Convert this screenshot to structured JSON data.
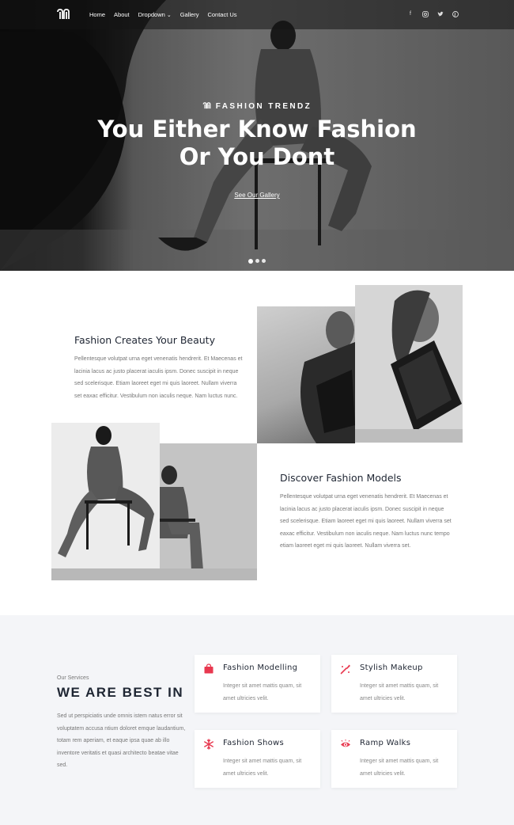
{
  "nav": {
    "items": [
      {
        "label": "Home"
      },
      {
        "label": "About"
      },
      {
        "label": "Dropdown"
      },
      {
        "label": "Gallery"
      },
      {
        "label": "Contact Us"
      }
    ],
    "social_icons": [
      "facebook-icon",
      "instagram-icon",
      "twitter-icon",
      "pinterest-icon"
    ]
  },
  "hero": {
    "eyebrow": "FASHION TRENDZ",
    "title_line1": "You Either Know Fashion",
    "title_line2": "Or You Dont",
    "cta": "See Our Gallery",
    "slides": 3,
    "active_slide": 1
  },
  "features": [
    {
      "title": "Fashion Creates Your Beauty",
      "body": "Pellentesque volutpat urna eget venenatis hendrerit. Et Maecenas et lacinia lacus ac justo placerat iaculis ipsm. Donec suscipit in neque sed scelerisque. Etiam laoreet eget mi quis laoreet. Nullam viverra set eaxac efficitur. Vestibulum non iaculis neque. Nam luctus nunc."
    },
    {
      "title": "Discover Fashion Models",
      "body": "Pellentesque volutpat urna eget venenatis hendrerit. Et Maecenas et lacinia lacus ac justo placerat iaculis ipsm. Donec suscipit in neque sed scelerisque. Etiam laoreet eget mi quis laoreet. Nullam viverra set eaxac efficitur. Vestibulum non iaculis neque. Nam luctus nunc tempo etiam laoreet eget mi quis laoreet. Nullam viverra set."
    }
  ],
  "services": {
    "eyebrow": "Our Services",
    "title": "WE ARE BEST IN",
    "description": "Sed ut perspiciatis unde omnis istem natus error sit voluptatem accusa ntium doloret emque laudantium, totam rem aperiam, et eaque ipsa quae ab illo inventore veritatis et quasi architecto beatae vitae sed.",
    "cards": [
      {
        "title": "Fashion Modelling",
        "text": "Integer sit amet mattis quam, sit amet ultricies velit.",
        "icon": "shopping-bag-icon"
      },
      {
        "title": "Stylish Makeup",
        "text": "Integer sit amet mattis quam, sit amet ultricies velit.",
        "icon": "makeup-brush-icon"
      },
      {
        "title": "Fashion Shows",
        "text": "Integer sit amet mattis quam, sit amet ultricies velit.",
        "icon": "snowflake-icon"
      },
      {
        "title": "Ramp Walks",
        "text": "Integer sit amet mattis quam, sit amet ultricies velit.",
        "icon": "eye-icon"
      }
    ]
  },
  "colors": {
    "accent": "#e8384f",
    "heading": "#1f2633",
    "services_bg": "#f4f5f8"
  }
}
